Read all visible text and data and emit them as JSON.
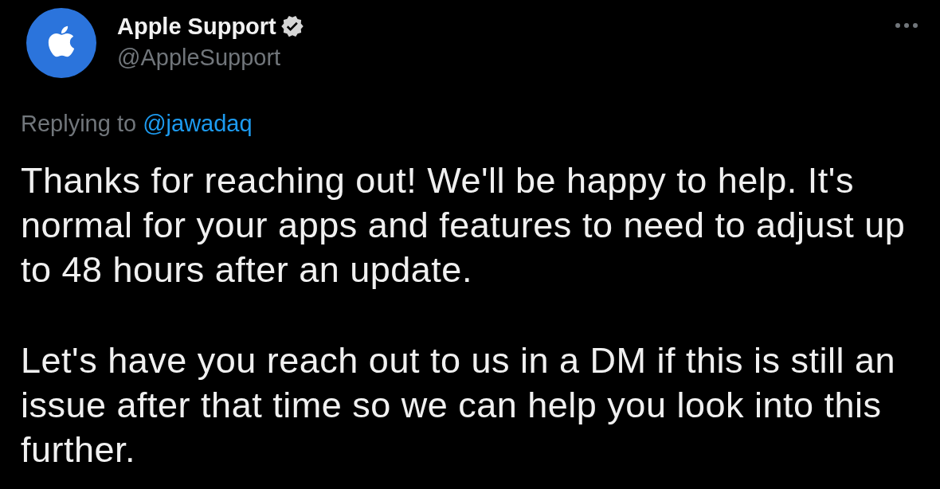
{
  "author": {
    "name": "Apple Support",
    "verified": true,
    "handle": "@AppleSupport"
  },
  "reply": {
    "prefix": "Replying to",
    "mention": "@jawadaq"
  },
  "body": [
    "Thanks for reaching out! We'll be happy to help. It's normal for your apps and features to need to adjust up to 48 hours after an update.",
    "Let's have you reach out to us in a DM if this is still an issue after that time so we can help you look into this further."
  ]
}
